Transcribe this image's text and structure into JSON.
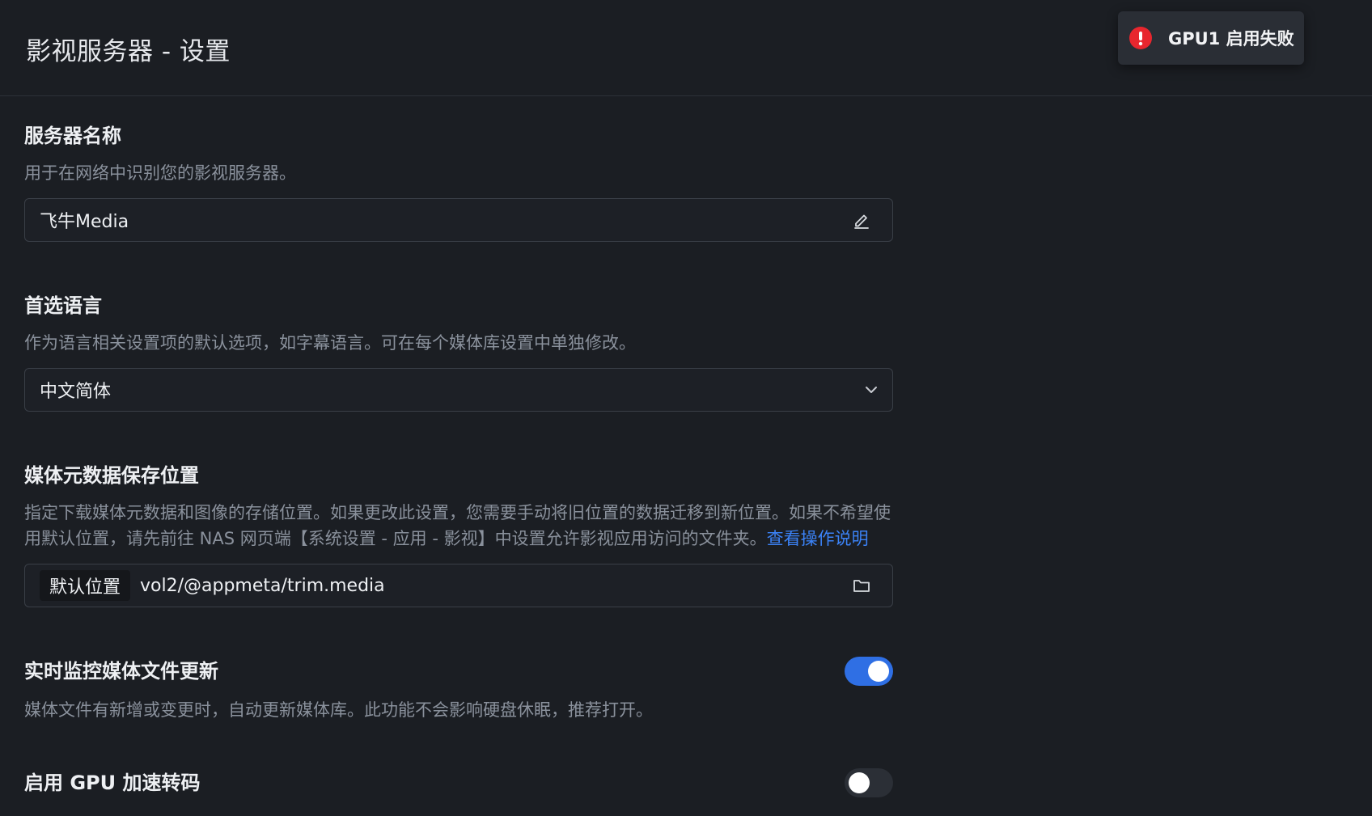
{
  "header": {
    "title": "影视服务器 - 设置"
  },
  "toast": {
    "icon": "error-icon",
    "message": "GPU1 启用失败",
    "color": "#e8262e"
  },
  "server_name": {
    "title": "服务器名称",
    "description": "用于在网络中识别您的影视服务器。",
    "value": "飞牛Media",
    "icon": "edit-pencil-icon"
  },
  "language": {
    "title": "首选语言",
    "description": "作为语言相关设置项的默认选项，如字幕语言。可在每个媒体库设置中单独修改。",
    "selected": "中文简体",
    "icon": "chevron-down-icon"
  },
  "metadata_location": {
    "title": "媒体元数据保存位置",
    "description": "指定下载媒体元数据和图像的存储位置。如果更改此设置，您需要手动将旧位置的数据迁移到新位置。如果不希望使用默认位置，请先前往 NAS 网页端【系统设置 - 应用 - 影视】中设置允许影视应用访问的文件夹。",
    "link_text": "查看操作说明",
    "chip_label": "默认位置",
    "path": "vol2/@appmeta/trim.media",
    "icon": "folder-icon"
  },
  "realtime_monitor": {
    "title": "实时监控媒体文件更新",
    "description": "媒体文件有新增或变更时，自动更新媒体库。此功能不会影响硬盘休眠，推荐打开。",
    "enabled": true,
    "color": "#2f6fe4"
  },
  "gpu_transcode": {
    "title": "启用 GPU 加速转码",
    "enabled": false
  }
}
